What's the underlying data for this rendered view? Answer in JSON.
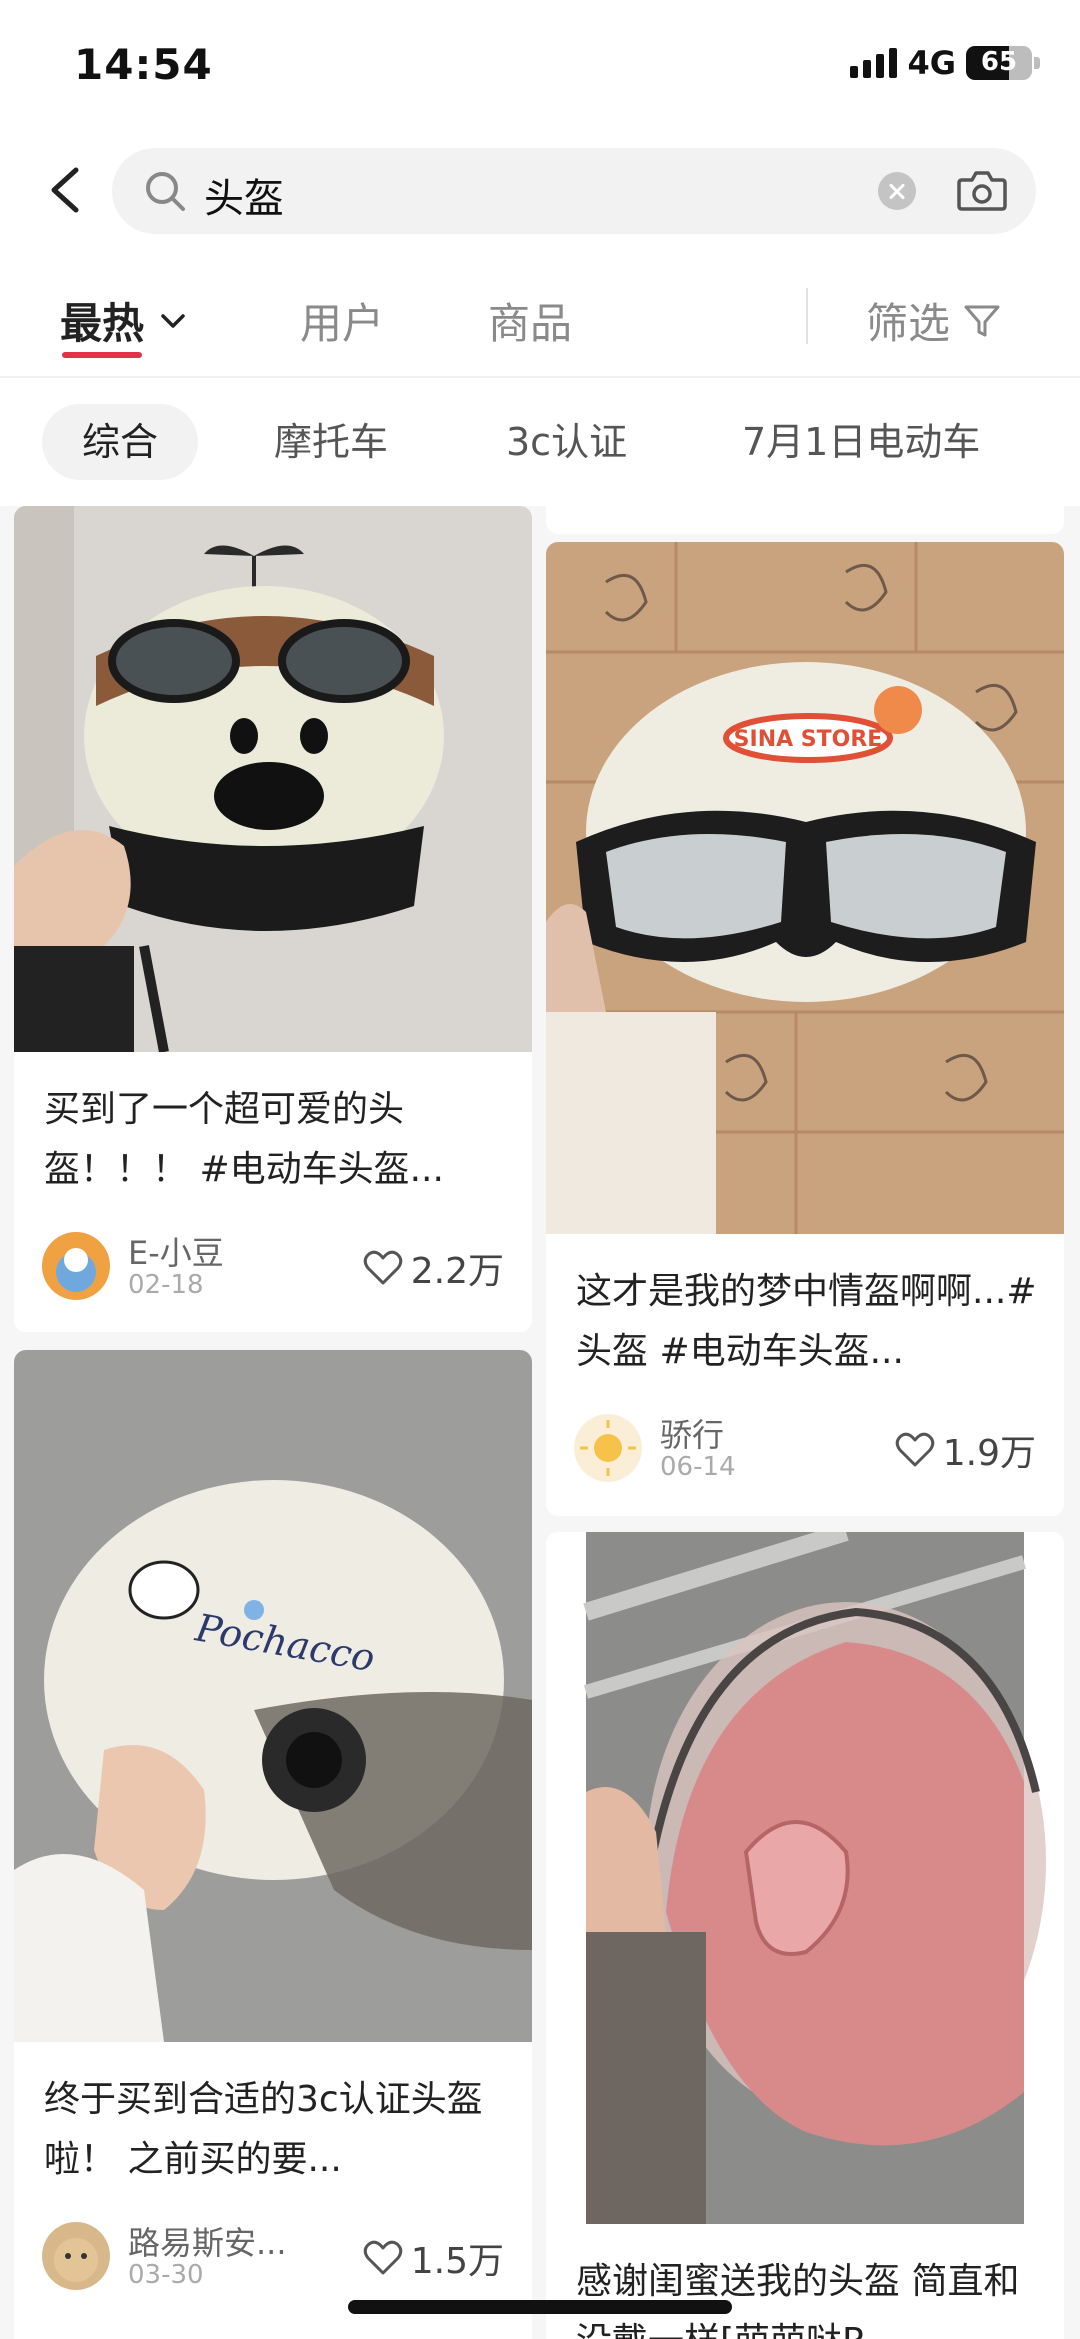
{
  "status_bar": {
    "time": "14:54",
    "network": "4G",
    "battery": "65",
    "battery_level": 0.65
  },
  "search": {
    "query": "头盔"
  },
  "tabs": [
    {
      "label": "最热"
    },
    {
      "label": "用户"
    },
    {
      "label": "商品"
    }
  ],
  "filter_label": "筛选",
  "chips": [
    "综合",
    "摩托车",
    "3c认证",
    "7月1日电动车"
  ],
  "posts": [
    {
      "title": "买到了一个超可爱的头盔！！！ #电动车头盔...",
      "author": "E-小豆",
      "date": "02-18",
      "likes": "2.2万"
    },
    {
      "title": "这才是我的梦中情盔啊啊...#头盔 #电动车头盔...",
      "author": "骄行",
      "date": "06-14",
      "likes": "1.9万"
    },
    {
      "title": "终于买到合适的3c认证头盔啦！ 之前买的要...",
      "author": "路易斯安...",
      "date": "03-30",
      "likes": "1.5万"
    },
    {
      "title": "感谢闺蜜送我的头盔 简直和没戴一样[萌萌哒R"
    }
  ],
  "photo_labels": {
    "sina_store": "SINA STORE",
    "pochacco": "Pochacco"
  },
  "colors": {
    "accent": "#e0334a",
    "feed_bg": "#f6f6f6"
  },
  "icons": [
    "back-icon",
    "search-icon",
    "clear-icon",
    "camera-icon",
    "chevron-down-icon",
    "filter-icon",
    "heart-icon"
  ]
}
